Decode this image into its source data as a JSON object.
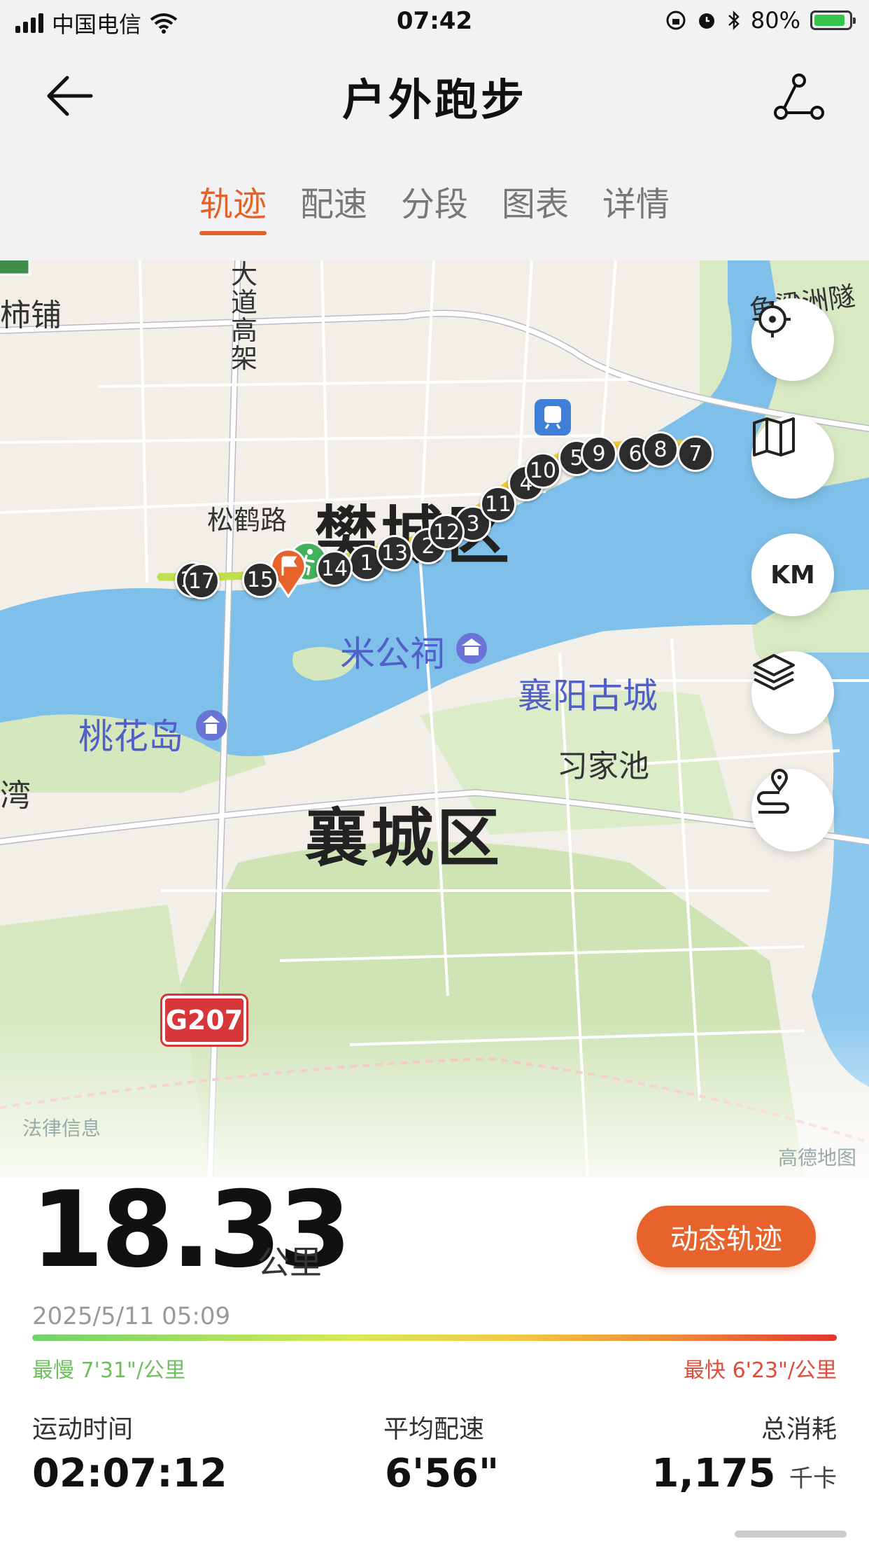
{
  "status_bar": {
    "carrier": "中国电信",
    "time": "07:42",
    "battery": "80%"
  },
  "header": {
    "title": "户外跑步",
    "tabs": [
      {
        "label": "轨迹",
        "active": true
      },
      {
        "label": "配速",
        "active": false
      },
      {
        "label": "分段",
        "active": false
      },
      {
        "label": "图表",
        "active": false
      },
      {
        "label": "详情",
        "active": false
      }
    ]
  },
  "map": {
    "labels": {
      "district_fancheng": "樊城区",
      "district_xiangcheng": "襄城区",
      "poi_migongci": "米公祠",
      "poi_gucheng": "襄阳古城",
      "poi_taohuadao": "桃花岛",
      "road_songhe": "松鹤路",
      "road_dadao": "大道高架",
      "place_shipu": "柿铺",
      "place_xijiachi": "习家池",
      "place_wan": "湾",
      "place_yuliangzhou": "鱼梁洲隧",
      "legal_info": "法律信息",
      "amap_logo": "高德地图",
      "road_shield": "G207"
    },
    "km_markers": [
      "1",
      "2",
      "3",
      "4",
      "5",
      "6",
      "7",
      "8",
      "9",
      "10",
      "11",
      "12",
      "13",
      "14",
      "15",
      "16",
      "17"
    ],
    "controls": {
      "locate": "locate-icon",
      "map_type": "map-icon",
      "km": "KM",
      "layers": "layers-icon",
      "route_pin": "route-pin-icon"
    }
  },
  "summary": {
    "distance": "18.33",
    "distance_unit": "公里",
    "replay_button": "动态轨迹",
    "date": "2025/5/11 05:09",
    "slowest": "最慢 7'31\"/公里",
    "fastest": "最快 6'23\"/公里",
    "stats": {
      "duration_label": "运动时间",
      "duration_value": "02:07:12",
      "pace_label": "平均配速",
      "pace_value": "6'56\"",
      "calories_label": "总消耗",
      "calories_value": "1,175",
      "calories_unit": "千卡"
    }
  },
  "colors": {
    "accent": "#e2632a",
    "river": "#7fc0ea",
    "land": "#f1efe8",
    "green": "#cfe3b4"
  }
}
